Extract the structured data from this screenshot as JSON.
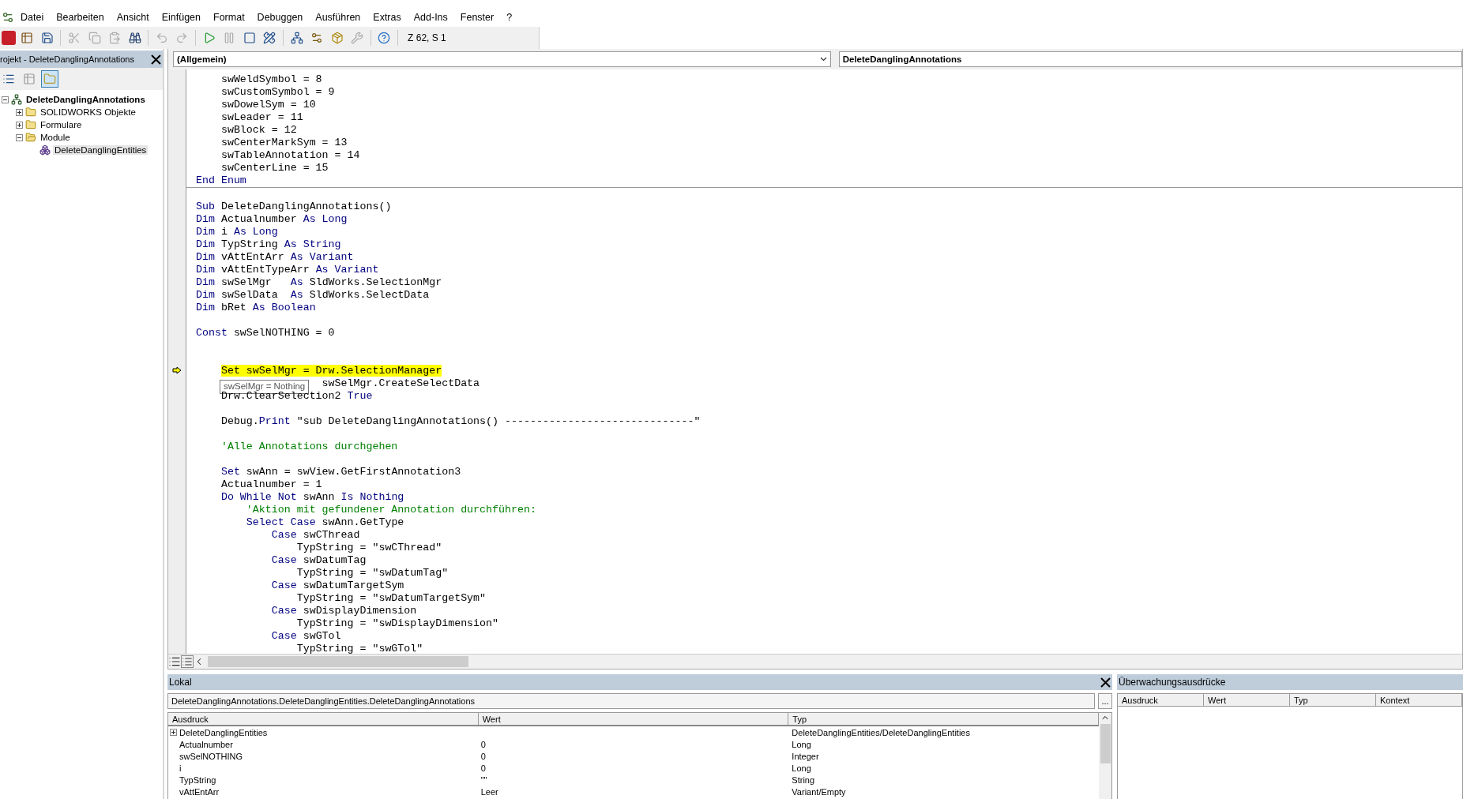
{
  "menu": [
    "Datei",
    "Bearbeiten",
    "Ansicht",
    "Einfügen",
    "Format",
    "Debuggen",
    "Ausführen",
    "Extras",
    "Add-Ins",
    "Fenster",
    "?"
  ],
  "toolbar": {
    "position": "Z 62, S 1"
  },
  "project": {
    "title": "rojekt - DeleteDanglingAnnotations",
    "tree": [
      {
        "label": "DeleteDanglingAnnotations",
        "kind": "project",
        "expanded": true,
        "selected": false,
        "children": [
          {
            "label": "SOLIDWORKS Objekte",
            "kind": "folder",
            "expanded": false,
            "selected": false
          },
          {
            "label": "Formulare",
            "kind": "folder",
            "expanded": false,
            "selected": false
          },
          {
            "label": "Module",
            "kind": "folder",
            "expanded": true,
            "selected": false,
            "children": [
              {
                "label": "DeleteDanglingEntities",
                "kind": "module",
                "selected": true
              }
            ]
          }
        ]
      }
    ]
  },
  "code": {
    "object": "(Allgemein)",
    "procedure": "DeleteDanglingAnnotations",
    "blocks": [
      [
        {
          "current": false,
          "segments": [
            {
              "text": "    swWeldSymbol = 8",
              "kind": "plain"
            }
          ]
        },
        {
          "current": false,
          "segments": [
            {
              "text": "    swCustomSymbol = 9",
              "kind": "plain"
            }
          ]
        },
        {
          "current": false,
          "segments": [
            {
              "text": "    swDowelSym = 10",
              "kind": "plain"
            }
          ]
        },
        {
          "current": false,
          "segments": [
            {
              "text": "    swLeader = 11",
              "kind": "plain"
            }
          ]
        },
        {
          "current": false,
          "segments": [
            {
              "text": "    swBlock = 12",
              "kind": "plain"
            }
          ]
        },
        {
          "current": false,
          "segments": [
            {
              "text": "    swCenterMarkSym = 13",
              "kind": "plain"
            }
          ]
        },
        {
          "current": false,
          "segments": [
            {
              "text": "    swTableAnnotation = 14",
              "kind": "plain"
            }
          ]
        },
        {
          "current": false,
          "segments": [
            {
              "text": "    swCenterLine = 15",
              "kind": "plain"
            }
          ]
        },
        {
          "current": false,
          "segments": [
            {
              "text": "End Enum",
              "kind": "keyword"
            }
          ]
        }
      ],
      [
        {
          "current": false
        },
        {
          "current": false,
          "segments": [
            {
              "text": "Sub",
              "kind": "keyword"
            },
            {
              "text": " DeleteDanglingAnnotations()",
              "kind": "plain"
            }
          ]
        },
        {
          "current": false,
          "segments": [
            {
              "text": "Dim",
              "kind": "keyword"
            },
            {
              "text": " Actualnumber ",
              "kind": "plain"
            },
            {
              "text": "As Long",
              "kind": "keyword"
            }
          ]
        },
        {
          "current": false,
          "segments": [
            {
              "text": "Dim",
              "kind": "keyword"
            },
            {
              "text": " i ",
              "kind": "plain"
            },
            {
              "text": "As Long",
              "kind": "keyword"
            }
          ]
        },
        {
          "current": false,
          "segments": [
            {
              "text": "Dim",
              "kind": "keyword"
            },
            {
              "text": " TypString ",
              "kind": "plain"
            },
            {
              "text": "As String",
              "kind": "keyword"
            }
          ]
        },
        {
          "current": false,
          "segments": [
            {
              "text": "Dim",
              "kind": "keyword"
            },
            {
              "text": " vAttEntArr ",
              "kind": "plain"
            },
            {
              "text": "As Variant",
              "kind": "keyword"
            }
          ]
        },
        {
          "current": false,
          "segments": [
            {
              "text": "Dim",
              "kind": "keyword"
            },
            {
              "text": " vAttEntTypeArr ",
              "kind": "plain"
            },
            {
              "text": "As Variant",
              "kind": "keyword"
            }
          ]
        },
        {
          "current": false,
          "segments": [
            {
              "text": "Dim",
              "kind": "keyword"
            },
            {
              "text": " swSelMgr   ",
              "kind": "plain"
            },
            {
              "text": "As",
              "kind": "keyword"
            },
            {
              "text": " SldWorks.SelectionMgr",
              "kind": "plain"
            }
          ]
        },
        {
          "current": false,
          "segments": [
            {
              "text": "Dim",
              "kind": "keyword"
            },
            {
              "text": " swSelData  ",
              "kind": "plain"
            },
            {
              "text": "As",
              "kind": "keyword"
            },
            {
              "text": " SldWorks.SelectData",
              "kind": "plain"
            }
          ]
        },
        {
          "current": false,
          "segments": [
            {
              "text": "Dim",
              "kind": "keyword"
            },
            {
              "text": " bRet ",
              "kind": "plain"
            },
            {
              "text": "As Boolean",
              "kind": "keyword"
            }
          ]
        },
        {
          "current": false
        },
        {
          "current": false,
          "segments": [
            {
              "text": "Const",
              "kind": "keyword"
            },
            {
              "text": " swSelNOTHING = 0",
              "kind": "plain"
            }
          ]
        },
        {
          "current": false
        },
        {
          "current": false
        },
        {
          "current": true,
          "segments": [
            {
              "text": "    Set swSelMgr = Drw.SelectionManager",
              "kind": "plain"
            }
          ]
        },
        {
          "current": false,
          "tooltip": "swSelMgr = Nothing",
          "segments": [
            {
              "text": "                    swSelMgr.CreateSelectData",
              "kind": "plain"
            }
          ]
        },
        {
          "current": false,
          "segments": [
            {
              "text": "    Drw.ClearSelection2 ",
              "kind": "plain"
            },
            {
              "text": "True",
              "kind": "keyword"
            }
          ]
        },
        {
          "current": false
        },
        {
          "current": false,
          "segments": [
            {
              "text": "    Debug.",
              "kind": "plain"
            },
            {
              "text": "Print",
              "kind": "keyword"
            },
            {
              "text": " \"sub DeleteDanglingAnnotations() ------------------------------\"",
              "kind": "plain"
            }
          ]
        },
        {
          "current": false
        },
        {
          "current": false,
          "segments": [
            {
              "text": "    'Alle Annotations durchgehen",
              "kind": "comment"
            }
          ]
        },
        {
          "current": false
        },
        {
          "current": false,
          "segments": [
            {
              "text": "    Set",
              "kind": "keyword"
            },
            {
              "text": " swAnn = swView.GetFirstAnnotation3",
              "kind": "plain"
            }
          ]
        },
        {
          "current": false,
          "segments": [
            {
              "text": "    Actualnumber = 1",
              "kind": "plain"
            }
          ]
        },
        {
          "current": false,
          "segments": [
            {
              "text": "    Do While Not",
              "kind": "keyword"
            },
            {
              "text": " swAnn ",
              "kind": "plain"
            },
            {
              "text": "Is Nothing",
              "kind": "keyword"
            }
          ]
        },
        {
          "current": false,
          "segments": [
            {
              "text": "        'Aktion mit gefundener Annotation durchführen:",
              "kind": "comment"
            }
          ]
        },
        {
          "current": false,
          "segments": [
            {
              "text": "        Select Case",
              "kind": "keyword"
            },
            {
              "text": " swAnn.GetType",
              "kind": "plain"
            }
          ]
        },
        {
          "current": false,
          "segments": [
            {
              "text": "            Case",
              "kind": "keyword"
            },
            {
              "text": " swCThread",
              "kind": "plain"
            }
          ]
        },
        {
          "current": false,
          "segments": [
            {
              "text": "                TypString = \"swCThread\"",
              "kind": "plain"
            }
          ]
        },
        {
          "current": false,
          "segments": [
            {
              "text": "            Case",
              "kind": "keyword"
            },
            {
              "text": " swDatumTag",
              "kind": "plain"
            }
          ]
        },
        {
          "current": false,
          "segments": [
            {
              "text": "                TypString = \"swDatumTag\"",
              "kind": "plain"
            }
          ]
        },
        {
          "current": false,
          "segments": [
            {
              "text": "            Case",
              "kind": "keyword"
            },
            {
              "text": " swDatumTargetSym",
              "kind": "plain"
            }
          ]
        },
        {
          "current": false,
          "segments": [
            {
              "text": "                TypString = \"swDatumTargetSym\"",
              "kind": "plain"
            }
          ]
        },
        {
          "current": false,
          "segments": [
            {
              "text": "            Case",
              "kind": "keyword"
            },
            {
              "text": " swDisplayDimension",
              "kind": "plain"
            }
          ]
        },
        {
          "current": false,
          "segments": [
            {
              "text": "                TypString = \"swDisplayDimension\"",
              "kind": "plain"
            }
          ]
        },
        {
          "current": false,
          "segments": [
            {
              "text": "            Case",
              "kind": "keyword"
            },
            {
              "text": " swGTol",
              "kind": "plain"
            }
          ]
        },
        {
          "current": false,
          "segments": [
            {
              "text": "                TypString = \"swGTol\"",
              "kind": "plain"
            }
          ]
        }
      ]
    ]
  },
  "locals": {
    "title": "Lokal",
    "context": "DeleteDanglingAnnotations.DeleteDanglingEntities.DeleteDanglingAnnotations",
    "more": "...",
    "columns": [
      "Ausdruck",
      "Wert",
      "Typ"
    ],
    "rows": [
      {
        "expression": "DeleteDanglingEntities",
        "value": "",
        "type": "DeleteDanglingEntities/DeleteDanglingEntities",
        "expandable": true
      },
      {
        "expression": "Actualnumber",
        "value": "0",
        "type": "Long",
        "expandable": false
      },
      {
        "expression": "swSelNOTHING",
        "value": "0",
        "type": "Integer",
        "expandable": false
      },
      {
        "expression": "i",
        "value": "0",
        "type": "Long",
        "expandable": false
      },
      {
        "expression": "TypString",
        "value": "\"\"",
        "type": "String",
        "expandable": false
      },
      {
        "expression": "vAttEntArr",
        "value": "Leer",
        "type": "Variant/Empty",
        "expandable": false
      }
    ]
  },
  "watch": {
    "title": "Überwachungsausdrücke",
    "columns": [
      "Ausdruck",
      "Wert",
      "Typ",
      "Kontext"
    ]
  }
}
